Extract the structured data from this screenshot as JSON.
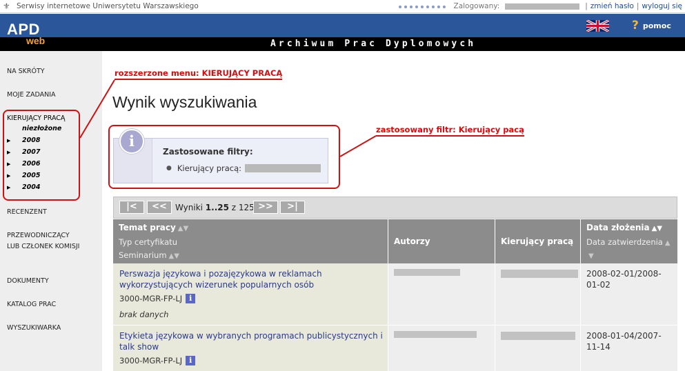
{
  "topbar": {
    "university": "Serwisy internetowe Uniwersytetu Warszawskiego",
    "logged_in_label": "Zalogowany:",
    "change_password": "zmień hasło",
    "logout": "wyloguj się",
    "separator": "|"
  },
  "header": {
    "logo_main": "APD",
    "logo_sub": "web",
    "archive_title": "Archiwum Prac Dyplomowych",
    "help_label": "pomoc",
    "help_glyph": "?",
    "colors": {
      "blue": "#2b569a",
      "black": "#000000",
      "orange": "#f3a23a"
    }
  },
  "sidebar": {
    "items": [
      {
        "label": "NA SKRÓTY"
      },
      {
        "label": "MOJE ZADANIA"
      },
      {
        "label": "KIERUJĄCY PRACĄ"
      },
      {
        "label": "RECENZENT"
      },
      {
        "label": "PRZEWODNICZĄCY LUB CZŁONEK KOMISJI"
      },
      {
        "label": "DOKUMENTY"
      },
      {
        "label": "KATALOG PRAC"
      },
      {
        "label": "WYSZUKIWARKA"
      }
    ],
    "subitems": [
      "niezłożone",
      "2008",
      "2007",
      "2006",
      "2005",
      "2004"
    ]
  },
  "annotations": {
    "menu": "rozszerzone menu: KIERUJĄCY PRACĄ",
    "filter": "zastosowany filtr: Kierujący pacą",
    "color": "#d01010"
  },
  "main": {
    "title": "Wynik wyszukiwania",
    "filters_title": "Zastosowane filtry:",
    "filter_item_label": "Kierujący pracą:"
  },
  "pager": {
    "first": "|<",
    "prev": "<<",
    "next": ">>",
    "last": ">|",
    "results_prefix": "Wyniki ",
    "results_range": "1..25",
    "results_of": " z 125"
  },
  "table": {
    "headers": {
      "topic": "Temat pracy",
      "cert_type": "Typ certyfikatu",
      "seminar": "Seminarium",
      "authors": "Autorzy",
      "supervisor": "Kierujący pracą",
      "date_submitted": "Data złożenia",
      "date_approved": "Data zatwierdzenia"
    },
    "rows": [
      {
        "title": "Perswazja językowa i pozajęzykowa w reklamach wykorzystujących wizerunek popularnych osób",
        "code": "3000-MGR-FP-LJ",
        "seminar": "brak danych",
        "dates": "2008-02-01/2008-01-02"
      },
      {
        "title": "Etykieta językowa w wybranych programach publicystycznych i talk show",
        "code": "3000-MGR-FP-LJ",
        "dates": "2008-01-04/2007-11-14"
      }
    ]
  }
}
